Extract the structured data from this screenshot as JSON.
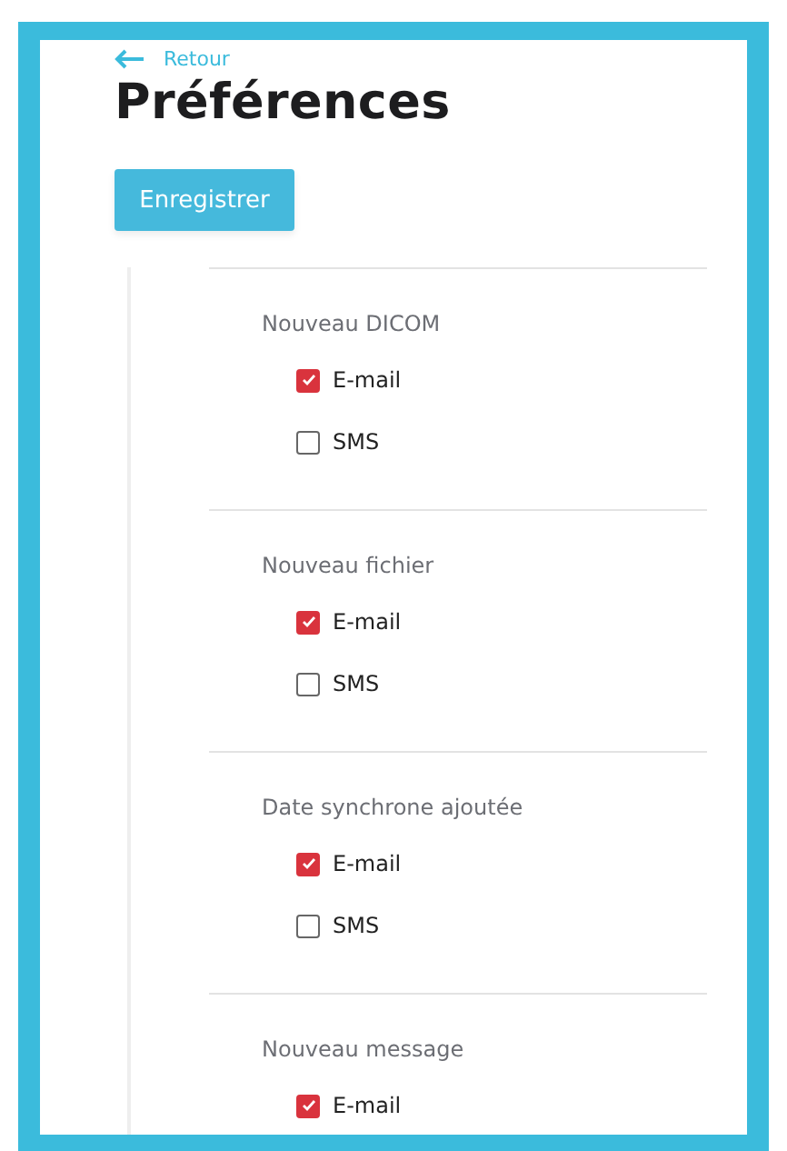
{
  "back_link": {
    "label": "Retour"
  },
  "title": "Préférences",
  "save_button": {
    "label": "Enregistrer"
  },
  "sections": [
    {
      "title": "Nouveau DICOM",
      "options": [
        {
          "label": "E-mail",
          "checked": true
        },
        {
          "label": "SMS",
          "checked": false
        }
      ]
    },
    {
      "title": "Nouveau fichier",
      "options": [
        {
          "label": "E-mail",
          "checked": true
        },
        {
          "label": "SMS",
          "checked": false
        }
      ]
    },
    {
      "title": "Date synchrone ajoutée",
      "options": [
        {
          "label": "E-mail",
          "checked": true
        },
        {
          "label": "SMS",
          "checked": false
        }
      ]
    },
    {
      "title": "Nouveau message",
      "options": [
        {
          "label": "E-mail",
          "checked": true
        }
      ]
    }
  ]
}
